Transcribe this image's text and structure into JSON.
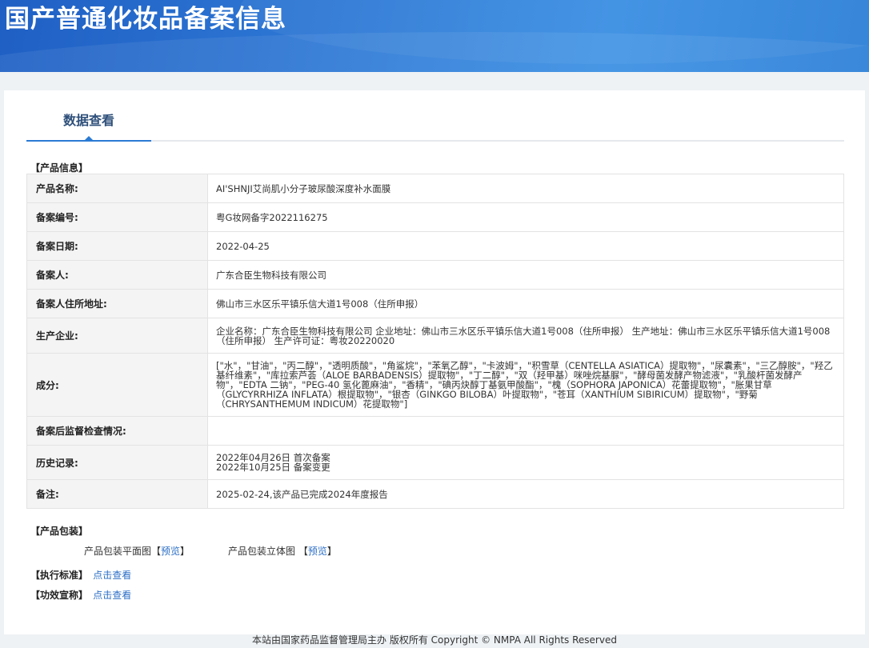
{
  "banner": {
    "title": "国产普通化妆品备案信息"
  },
  "tabs": {
    "active": "数据查看"
  },
  "product_section": {
    "title": "【产品信息】"
  },
  "rows": [
    {
      "key": "产品名称:",
      "value": "AI'SHNJI艾尚肌小分子玻尿酸深度补水面膜"
    },
    {
      "key": "备案编号:",
      "value": "粤G妆网备字2022116275"
    },
    {
      "key": "备案日期:",
      "value": "2022-04-25"
    },
    {
      "key": "备案人:",
      "value": "广东合臣生物科技有限公司"
    },
    {
      "key": "备案人住所地址:",
      "value": "佛山市三水区乐平镇乐信大道1号008（住所申报）"
    },
    {
      "key": "生产企业:",
      "value": "企业名称：广东合臣生物科技有限公司 企业地址：佛山市三水区乐平镇乐信大道1号008（住所申报） 生产地址：佛山市三水区乐平镇乐信大道1号008（住所申报） 生产许可证：粤妆20220020"
    },
    {
      "key": "成分:",
      "value": "[\"水\"，\"甘油\"，\"丙二醇\"，\"透明质酸\"，\"角鲨烷\"，\"苯氧乙醇\"，\"卡波姆\"，\"积雪草（CENTELLA ASIATICA）提取物\"，\"尿囊素\"，\"三乙醇胺\"，\"羟乙基纤维素\"，\"库拉索芦荟（ALOE BARBADENSIS）提取物\"，\"丁二醇\"，\"双（羟甲基）咪唑烷基脲\"，\"酵母菌发酵产物滤液\"，\"乳酸杆菌发酵产物\"，\"EDTA 二钠\"，\"PEG-40 氢化蓖麻油\"，\"香精\"，\"碘丙炔醇丁基氨甲酸酯\"，\"槐（SOPHORA JAPONICA）花蕾提取物\"，\"胀果甘草（GLYCYRRHIZA INFLATA）根提取物\"，\"银杏（GINKGO BILOBA）叶提取物\"，\"苍耳（XANTHIUM SIBIRICUM）提取物\"，\"野菊（CHRYSANTHEMUM INDICUM）花提取物\"]"
    },
    {
      "key": "备案后监督检查情况:",
      "value": ""
    },
    {
      "key": "历史记录:",
      "value": "2022年04月26日 首次备案",
      "value2": "2022年10月25日 备案变更"
    },
    {
      "key": "备注:",
      "value": "2025-02-24,该产品已完成2024年度报告"
    }
  ],
  "packaging": {
    "title": "【产品包装】",
    "flat_label": "产品包装平面图",
    "flat_link": "预览",
    "solid_label": "产品包装立体图",
    "solid_link": "预览",
    "bracket_left": "【",
    "bracket_right": "】"
  },
  "standard": {
    "title": "【执行标准】",
    "link": "点击查看"
  },
  "efficacy": {
    "title": "【功效宣称】",
    "link": "点击查看"
  },
  "footer": {
    "text": "本站由国家药品监督管理局主办 版权所有 Copyright © NMPA All Rights Reserved"
  },
  "colors": {
    "banner": "#2f7ad6",
    "link": "#2c6fc6",
    "table_border": "#a9c4e4",
    "tab_accent": "#2a7bd4"
  }
}
